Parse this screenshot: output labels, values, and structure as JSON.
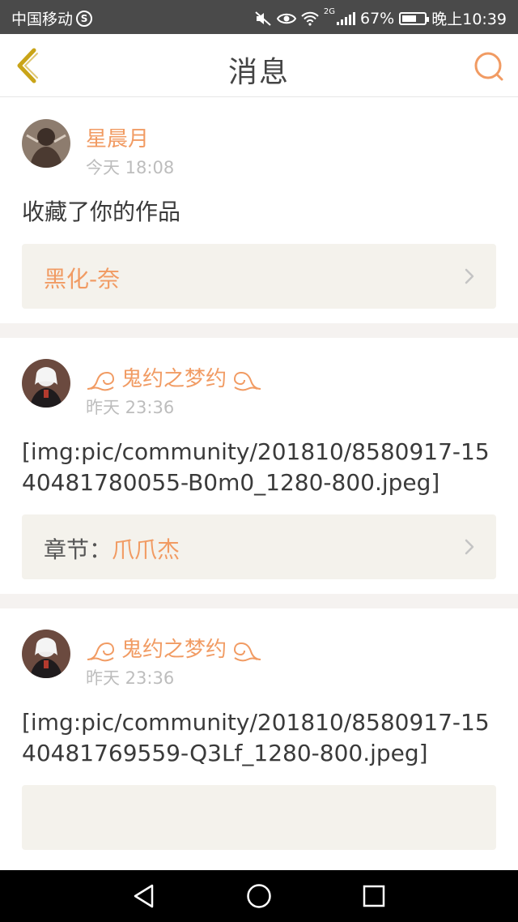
{
  "status_bar": {
    "carrier": "中国移动",
    "carrier_badge": "S",
    "network_type": "2G",
    "battery_percent": "67%",
    "battery_level": 0.67,
    "time": "晚上10:39"
  },
  "header": {
    "title": "消息",
    "back_icon": "chevron-left-icon",
    "search_icon": "search-icon"
  },
  "colors": {
    "accent": "#f19b63",
    "link_box_bg": "#f4f2ec",
    "back_icon": "#c9a418"
  },
  "messages": [
    {
      "username": "星晨月",
      "time": "今天 18:08",
      "content": "收藏了你的作品",
      "link_prefix": "",
      "link_target": "黑化-奈"
    },
    {
      "username": "鬼约之梦约",
      "time": "昨天 23:36",
      "content": "[img:pic/community/201810/8580917-1540481780055-B0m0_1280-800.jpeg]",
      "link_prefix": "章节：",
      "link_target": "爪爪杰"
    },
    {
      "username": "鬼约之梦约",
      "time": "昨天 23:36",
      "content": "[img:pic/community/201810/8580917-1540481769559-Q3Lf_1280-800.jpeg]",
      "link_prefix": "",
      "link_target": ""
    }
  ],
  "nav_bar": {
    "back": "triangle-back-icon",
    "home": "circle-home-icon",
    "recents": "square-recents-icon"
  }
}
